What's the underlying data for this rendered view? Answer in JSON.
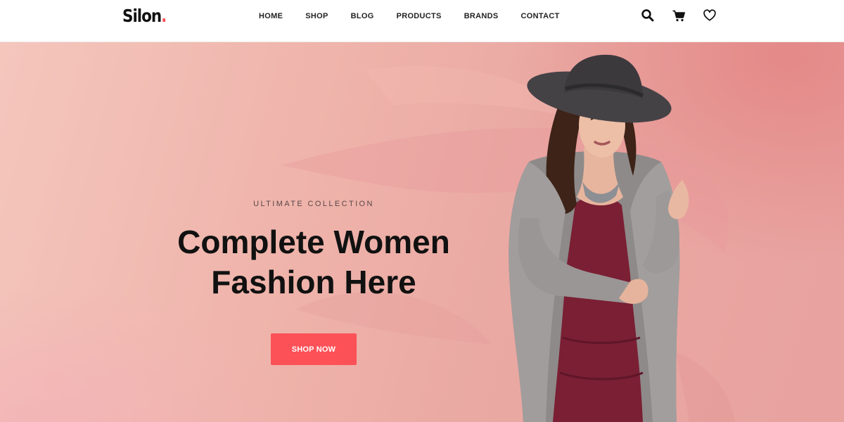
{
  "header": {
    "logo_text": "Silon",
    "logo_dot": ".",
    "nav": [
      "HOME",
      "SHOP",
      "BLOG",
      "PRODUCTS",
      "BRANDS",
      "CONTACT"
    ],
    "icons": [
      "search-icon",
      "cart-icon",
      "heart-icon"
    ]
  },
  "hero": {
    "eyebrow": "ULTIMATE COLLECTION",
    "headline_line1": "Complete Women",
    "headline_line2": "Fashion Here",
    "cta_label": "SHOP NOW",
    "image_subject": "Woman in a grey wide-brim hat, long grey cardigan and burgundy dress"
  },
  "colors": {
    "accent": "#fb5157",
    "hero_background": "#eeb0a8",
    "text_dark": "#111111"
  }
}
